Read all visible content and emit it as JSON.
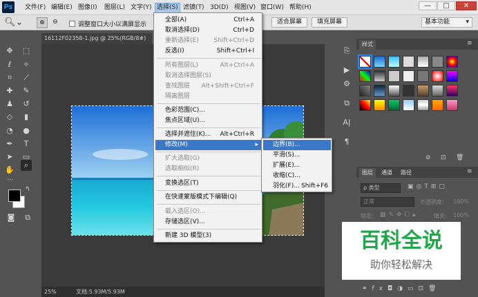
{
  "app": {
    "logo": "Ps"
  },
  "menubar": {
    "items": [
      "文件(F)",
      "编辑(E)",
      "图像(I)",
      "图层(L)",
      "文字(Y)",
      "选择(S)",
      "滤镜(T)",
      "3D(D)",
      "视图(V)",
      "窗口(W)",
      "帮助(H)"
    ],
    "window_buttons": [
      "—",
      "□",
      "✕"
    ]
  },
  "options_bar": {
    "zoom_resize_label": "调整窗口大小以满屏显示",
    "fit_screen": "适合屏幕",
    "fill_screen": "填充屏幕",
    "workspace": "基本功能"
  },
  "document": {
    "tab_title": "16112F02358-1.jpg @ 25%(RGB/8#)",
    "zoom": "25%",
    "doc_size": "文档:5.93M/5.93M"
  },
  "select_menu": {
    "items": [
      {
        "label": "全部(A)",
        "shortcut": "Ctrl+A",
        "enabled": true
      },
      {
        "label": "取消选择(D)",
        "shortcut": "Ctrl+D",
        "enabled": true
      },
      {
        "label": "重新选择(E)",
        "shortcut": "Shift+Ctrl+D",
        "enabled": false
      },
      {
        "label": "反选(I)",
        "shortcut": "Shift+Ctrl+I",
        "enabled": true
      },
      {
        "label": "所有图层(L)",
        "shortcut": "Alt+Ctrl+A",
        "enabled": false
      },
      {
        "label": "取消选择图层(S)",
        "shortcut": "",
        "enabled": false
      },
      {
        "label": "查找图层",
        "shortcut": "Alt+Shift+Ctrl+F",
        "enabled": false
      },
      {
        "label": "隔离图层",
        "shortcut": "",
        "enabled": false
      },
      {
        "label": "色彩范围(C)...",
        "shortcut": "",
        "enabled": true
      },
      {
        "label": "焦点区域(U)...",
        "shortcut": "",
        "enabled": true
      },
      {
        "label": "选择并遮住(K)...",
        "shortcut": "Alt+Ctrl+R",
        "enabled": true
      },
      {
        "label": "修改(M)",
        "shortcut": "",
        "enabled": true
      },
      {
        "label": "扩大选取(G)",
        "shortcut": "",
        "enabled": false
      },
      {
        "label": "选取相似(R)",
        "shortcut": "",
        "enabled": false
      },
      {
        "label": "变换选区(T)",
        "shortcut": "",
        "enabled": true
      },
      {
        "label": "在快速蒙版模式下编辑(Q)",
        "shortcut": "",
        "enabled": true
      },
      {
        "label": "载入选区(O)...",
        "shortcut": "",
        "enabled": false
      },
      {
        "label": "存储选区(V)...",
        "shortcut": "",
        "enabled": true
      },
      {
        "label": "新建 3D 模型(3)",
        "shortcut": "",
        "enabled": true
      }
    ]
  },
  "modify_submenu": {
    "items": [
      {
        "label": "边界(B)...",
        "shortcut": ""
      },
      {
        "label": "平滑(S)...",
        "shortcut": ""
      },
      {
        "label": "扩展(E)...",
        "shortcut": ""
      },
      {
        "label": "收缩(C)...",
        "shortcut": ""
      },
      {
        "label": "羽化(F)...",
        "shortcut": "Shift+F6"
      }
    ]
  },
  "styles_panel": {
    "tab": "样式"
  },
  "layers_panel": {
    "tabs": [
      "图层",
      "通道",
      "路径"
    ],
    "filter_kind": "ρ 类型",
    "blend_mode": "正常",
    "opacity_label": "不透明度:",
    "opacity_value": "100%",
    "lock_label": "锁定:",
    "fill_label": "填充:",
    "fill_value": "100%"
  },
  "watermark": {
    "title": "百科全说",
    "subtitle": "助你轻松解决"
  }
}
